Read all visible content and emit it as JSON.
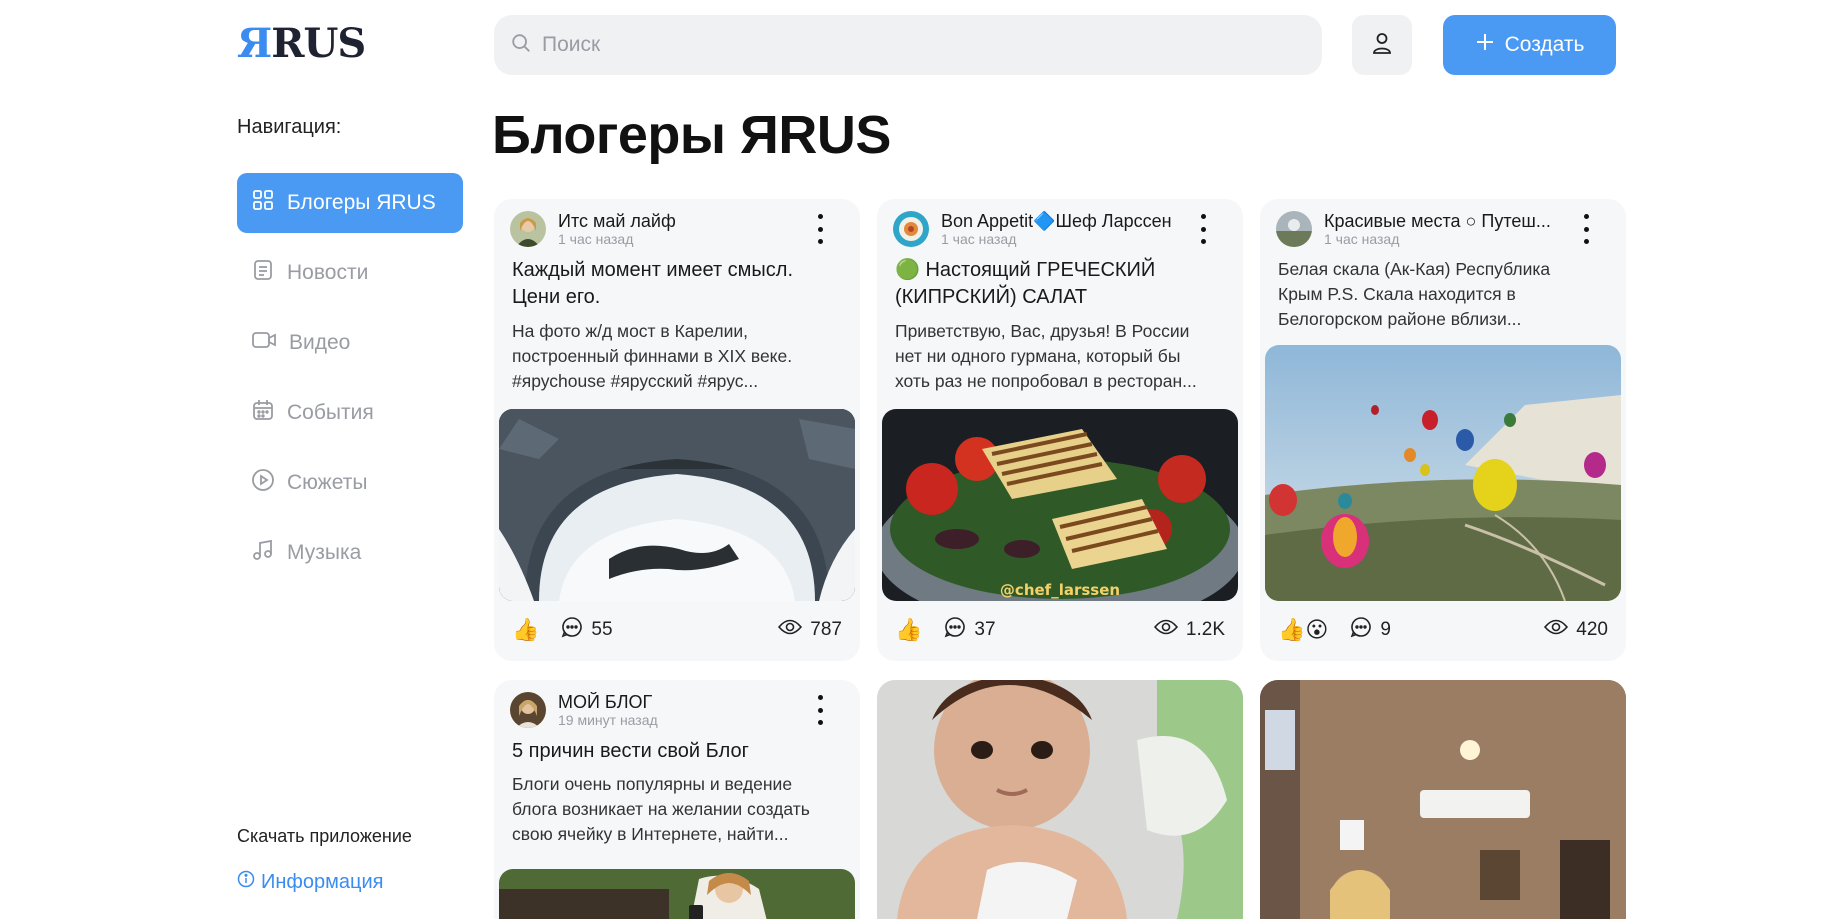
{
  "app": {
    "logo_first": "Я",
    "logo_rest": "RUS"
  },
  "search": {
    "placeholder": "Поиск",
    "value": ""
  },
  "header": {
    "create_label": "Создать"
  },
  "sidebar": {
    "title": "Навигация:",
    "items": [
      {
        "label": "Блогеры ЯRUS",
        "icon": "grid-icon",
        "active": true
      },
      {
        "label": "Новости",
        "icon": "document-icon"
      },
      {
        "label": "Видео",
        "icon": "video-icon"
      },
      {
        "label": "События",
        "icon": "calendar-icon"
      },
      {
        "label": "Сюжеты",
        "icon": "play-circle-icon"
      },
      {
        "label": "Музыка",
        "icon": "music-note-icon"
      }
    ],
    "download_label": "Скачать приложение",
    "info_label": "Информация"
  },
  "main": {
    "title": "Блогеры ЯRUS",
    "posts": [
      {
        "author": "Итс май лайф",
        "time": "1 час назад",
        "title": "Каждый момент имеет смысл. Цени его.",
        "text_lines": [
          "На фото ж/д мост в Карелии,",
          "построенный финнами в XIX веке.",
          "#ярусhouse #ярусский #ярус..."
        ],
        "reactions": "👍",
        "comments": "55",
        "views": "787"
      },
      {
        "author": "Bon Appetit🔷Шеф Ларссен",
        "time": "1 час назад",
        "title": "🟢 Настоящий ГРЕЧЕСКИЙ (КИПРСКИЙ) САЛАТ",
        "text_lines": [
          "Приветствую, Вас, друзья! В России",
          "нет ни одного гурмана, который бы",
          "хоть раз не попробовал в ресторан..."
        ],
        "image_watermark": "@chef_larssen",
        "reactions": "👍",
        "comments": "37",
        "views": "1.2K"
      },
      {
        "author": "Красивые места ○ Путеш...",
        "time": "1 час назад",
        "text_lines": [
          "Белая скала (Ак-Кая) Республика",
          "Крым P.S. Скала находится в",
          "Белогорском районе вблизи..."
        ],
        "reactions": "👍😮",
        "comments": "9",
        "views": "420"
      },
      {
        "author": "МОЙ БЛОГ",
        "time": "19 минут назад",
        "title": "5 причин вести свой Блог",
        "text_lines": [
          "Блоги очень популярны и ведение",
          "блога возникает на желании создать",
          "свою ячейку в Интернете, найти..."
        ]
      }
    ]
  }
}
